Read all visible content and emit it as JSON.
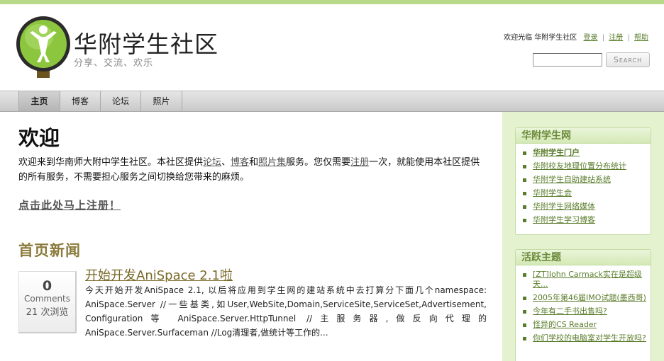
{
  "site": {
    "title": "华附学生社区",
    "subtitle": "分享、交流、欢乐"
  },
  "userbar": {
    "welcome": "欢迎光临 华附学生社区",
    "login": "登录",
    "register": "注册",
    "help": "帮助"
  },
  "search": {
    "placeholder": "",
    "button": "Search"
  },
  "nav": {
    "tabs": [
      {
        "label": "主页",
        "active": true
      },
      {
        "label": "博客"
      },
      {
        "label": "论坛"
      },
      {
        "label": "照片"
      }
    ]
  },
  "welcome": {
    "title": "欢迎",
    "text_1": "欢迎来到华南师大附中学生社区。本社区提供",
    "link_forum": "论坛",
    "text_2": "、",
    "link_blog": "博客",
    "text_3": "和",
    "link_photos": "照片集",
    "text_4": "服务。您仅需要",
    "link_register": "注册",
    "text_5": "一次，就能使用本社区提供的所有服务，不需要担心服务之间切换给您带来的麻烦。",
    "cta": "点击此处马上注册！"
  },
  "news": {
    "heading": "首页新闻",
    "post": {
      "comment_count": "0",
      "comments_label": "Comments",
      "views": "21 次浏览",
      "title": "开始开发AniSpace 2.1啦",
      "excerpt": "今天开始开发AniSpace 2.1, 以后将应用到学生网的建站系统中去打算分下面几个namespace: AniSpace.Server //一些基类,如User,WebSite,Domain,ServiceSite,ServiceSet,Advertisement, Configuration等 AniSpace.Server.HttpTunnel //主服务器,做反向代理的 AniSpace.Server.Surfaceman //Log清理者,做统计等工作的..."
    }
  },
  "sidebar": {
    "network": {
      "title": "华附学生网",
      "items": [
        "华附学生门户",
        "华附校友地理位置分布统计",
        "华附学生自助建站系统",
        "华附学生会",
        "华附学生网络媒体",
        "华附学生学习博客"
      ]
    },
    "topics": {
      "title": "活跃主题",
      "items": [
        "[ZT]John Carmack实在是超级天...",
        "2005年第46届IMO试题(墨西哥)",
        "今年有二手书出售吗?",
        "怪异的CS Reader",
        "你们学校的电脑室对学生开放吗?"
      ]
    }
  },
  "colors": {
    "accent_green": "#5a7d2b",
    "sidebar_bg": "#e4f2d0",
    "news_heading": "#8a7a3a",
    "logo_green": "#8cc63f",
    "logo_trunk": "#6b5420"
  },
  "icons": {
    "logo": "tree-person-logo-icon"
  }
}
